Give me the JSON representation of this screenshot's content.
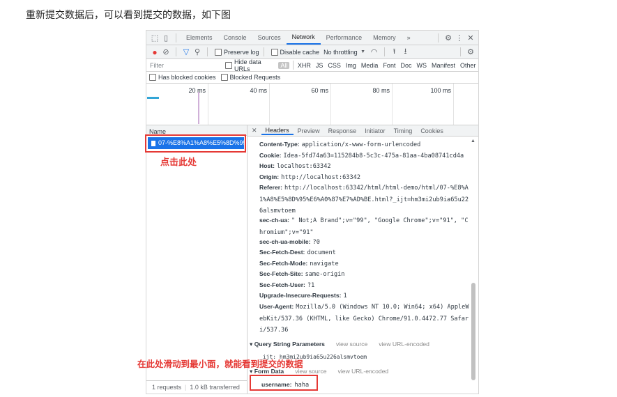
{
  "caption": "重新提交数据后，可以看到提交的数据，如下图",
  "devtools": {
    "top_tabs": [
      "Elements",
      "Console",
      "Sources",
      "Network",
      "Performance",
      "Memory"
    ],
    "active_tab": "Network",
    "more": "»",
    "toolbar": {
      "preserve_log": "Preserve log",
      "disable_cache": "Disable cache",
      "throttling": "No throttling"
    },
    "filter": {
      "placeholder": "Filter",
      "hide_data_urls": "Hide data URLs",
      "all": "All",
      "types": [
        "XHR",
        "JS",
        "CSS",
        "Img",
        "Media",
        "Font",
        "Doc",
        "WS",
        "Manifest",
        "Other"
      ]
    },
    "blocked": {
      "has_blocked_cookies": "Has blocked cookies",
      "blocked_requests": "Blocked Requests"
    },
    "timeline_ticks": [
      "20 ms",
      "40 ms",
      "60 ms",
      "80 ms",
      "100 ms"
    ],
    "name_column": "Name",
    "request_name": "07-%E8%A1%A8%E5%8D%95...",
    "annotation_click": "点击此处",
    "footer": {
      "requests": "1 requests",
      "transferred": "1.0 kB transferred"
    },
    "detail_tabs": [
      "Headers",
      "Preview",
      "Response",
      "Initiator",
      "Timing",
      "Cookies"
    ],
    "active_detail_tab": "Headers",
    "headers": [
      {
        "k": "Content-Type:",
        "v": "application/x-www-form-urlencoded"
      },
      {
        "k": "Cookie:",
        "v": "Idea-5fd74a63=115284b8-5c3c-475a-81aa-4ba08741cd4a"
      },
      {
        "k": "Host:",
        "v": "localhost:63342"
      },
      {
        "k": "Origin:",
        "v": "http://localhost:63342"
      },
      {
        "k": "Referer:",
        "v": "http://localhost:63342/html/html-demo/html/07-%E8%A1%A8%E5%8D%95%E6%A0%87%E7%AD%BE.html?_ijt=hm3mi2ub9ia65u226alsmvtoem"
      },
      {
        "k": "sec-ch-ua:",
        "v": "\" Not;A Brand\";v=\"99\", \"Google Chrome\";v=\"91\", \"Chromium\";v=\"91\""
      },
      {
        "k": "sec-ch-ua-mobile:",
        "v": "?0"
      },
      {
        "k": "Sec-Fetch-Dest:",
        "v": "document"
      },
      {
        "k": "Sec-Fetch-Mode:",
        "v": "navigate"
      },
      {
        "k": "Sec-Fetch-Site:",
        "v": "same-origin"
      },
      {
        "k": "Sec-Fetch-User:",
        "v": "?1"
      },
      {
        "k": "Upgrade-Insecure-Requests:",
        "v": "1"
      },
      {
        "k": "User-Agent:",
        "v": "Mozilla/5.0 (Windows NT 10.0; Win64; x64) AppleWebKit/537.36 (KHTML, like Gecko) Chrome/91.0.4472.77 Safari/537.36"
      }
    ],
    "query_string": {
      "title": "▾ Query String Parameters",
      "view_source": "view source",
      "view_url_encoded": "view URL-encoded",
      "param": "_ijt: hm3mi2ub9ia65u226alsmvtoem"
    },
    "form_data": {
      "title": "▾ Form Data",
      "view_source": "view source",
      "view_url_encoded": "view URL-encoded",
      "key": "username:",
      "value": "haha"
    },
    "annotation_scroll": "在此处滑动到最小面，就能看到提交的数据"
  }
}
